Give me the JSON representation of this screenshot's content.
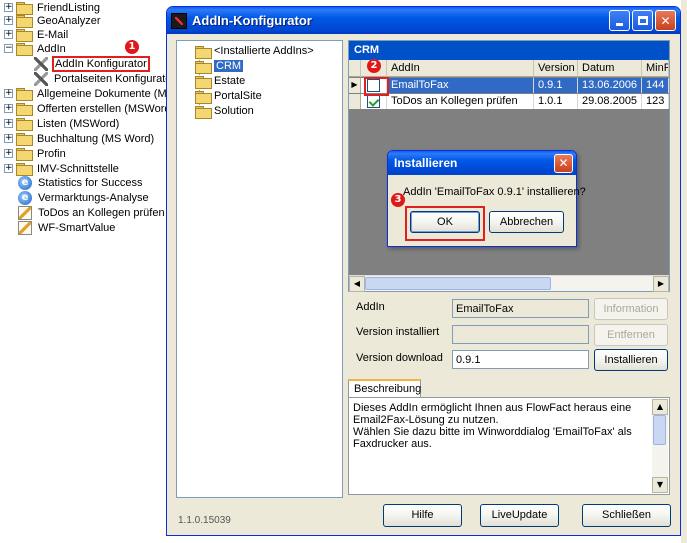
{
  "left_tree": {
    "items": [
      {
        "label": "FriendListing",
        "expander": "+",
        "icon": "folder-icon"
      },
      {
        "label": "GeoAnalyzer",
        "expander": "+",
        "icon": "folder-icon"
      },
      {
        "label": "E-Mail",
        "expander": "+",
        "icon": "folder-icon"
      },
      {
        "label": "AddIn",
        "expander": "−",
        "icon": "folder-open-icon"
      },
      {
        "label": "AddIn Konfigurator",
        "expander": "",
        "icon": "tools-icon"
      },
      {
        "label": "Portalseiten Konfigurator",
        "expander": "",
        "icon": "tools-icon"
      },
      {
        "label": "Allgemeine Dokumente (MS W",
        "expander": "+",
        "icon": "folder-icon"
      },
      {
        "label": "Offerten erstellen (MSWord)",
        "expander": "+",
        "icon": "folder-icon"
      },
      {
        "label": "Listen (MSWord)",
        "expander": "+",
        "icon": "folder-icon"
      },
      {
        "label": "Buchhaltung (MS Word)",
        "expander": "+",
        "icon": "folder-icon"
      },
      {
        "label": "Profin",
        "expander": "+",
        "icon": "folder-icon"
      },
      {
        "label": "IMV-Schnittstelle",
        "expander": "+",
        "icon": "folder-icon"
      },
      {
        "label": "Statistics for Success",
        "expander": "",
        "icon": "ie-icon"
      },
      {
        "label": "Vermarktungs-Analyse",
        "expander": "",
        "icon": "ie-icon"
      },
      {
        "label": "ToDos an Kollegen prüfen",
        "expander": "",
        "icon": "pencil-icon"
      },
      {
        "label": "WF-SmartValue",
        "expander": "",
        "icon": "pencil-icon"
      }
    ]
  },
  "badges": {
    "one": "1",
    "two": "2",
    "three": "3"
  },
  "window": {
    "title": "AddIn-Konfigurator",
    "tree": [
      {
        "label": "<Installierte AddIns>"
      },
      {
        "label": "CRM",
        "selected": true
      },
      {
        "label": "Estate"
      },
      {
        "label": "PortalSite"
      },
      {
        "label": "Solution"
      }
    ],
    "panel_header": "CRM",
    "grid": {
      "columns": [
        "AddIn",
        "Version",
        "Datum",
        "MinF"
      ],
      "rows": [
        {
          "addin": "EmailToFax",
          "version": "0.9.1",
          "datum": "13.06.2006",
          "minf": "144",
          "checked": false,
          "selected": true
        },
        {
          "addin": "ToDos an Kollegen prüfen",
          "version": "1.0.1",
          "datum": "29.08.2005",
          "minf": "123",
          "checked": true,
          "selected": false
        }
      ]
    },
    "form": {
      "addin_label": "AddIn",
      "addin_value": "EmailToFax",
      "installed_label": "Version installiert",
      "installed_value": "",
      "download_label": "Version download",
      "download_value": "0.9.1",
      "information_button": "Information",
      "remove_button": "Entfernen",
      "install_button": "Installieren"
    },
    "description": {
      "tab_label": "Beschreibung",
      "text": "Dieses AddIn ermöglicht Ihnen aus FlowFact heraus eine\nEmail2Fax-Lösung zu nutzen.\nWählen Sie dazu bitte im Winworddialog 'EmailToFax' als\nFaxdrucker aus."
    },
    "version": "1.1.0.15039",
    "footer": {
      "help": "Hilfe",
      "liveupdate": "LiveUpdate",
      "close": "Schließen"
    }
  },
  "dialog": {
    "title": "Installieren",
    "message": "AddIn 'EmailToFax 0.9.1' installieren?",
    "ok": "OK",
    "cancel": "Abbrechen"
  },
  "colors": {
    "selection": "#316ac5",
    "annotation_red": "#e02020",
    "titlebar_blue": "#0058e6"
  }
}
